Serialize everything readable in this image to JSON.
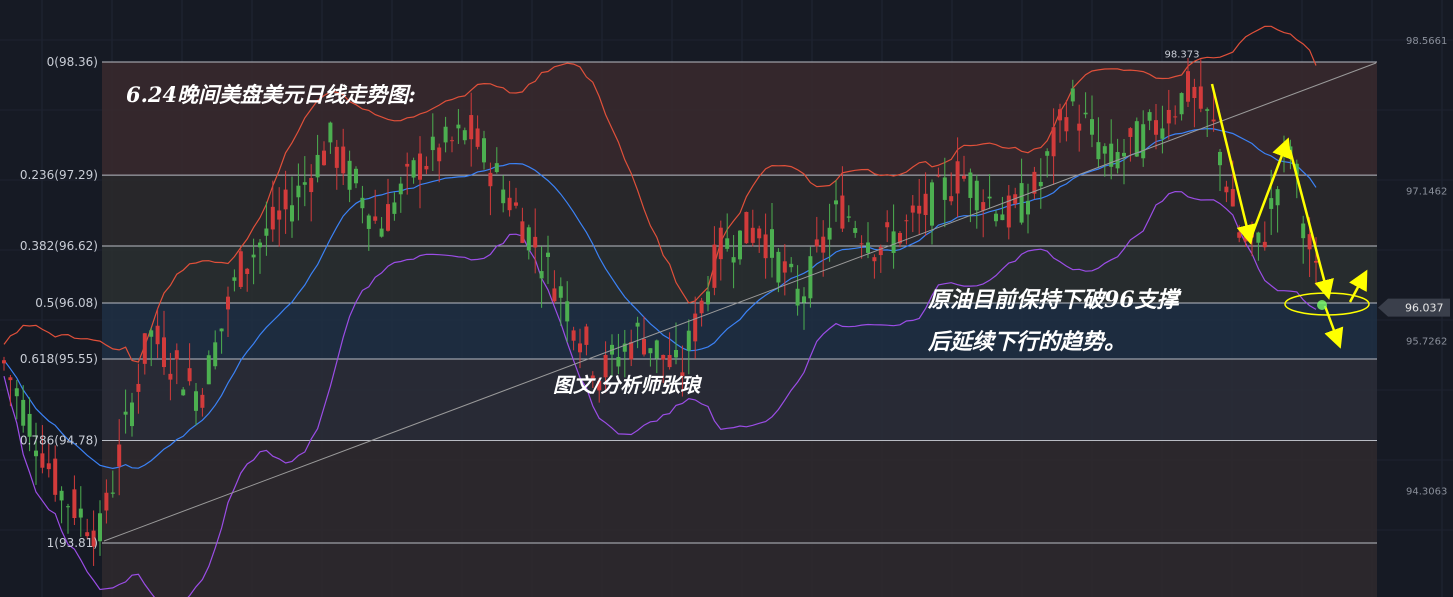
{
  "chart_data": {
    "type": "candlestick",
    "title": "6.24晚间美盘美元日线走势图:",
    "colors": {
      "background": "#161a24",
      "up": "#d23b3b",
      "down": "#4caf50",
      "upper_band": "#e0503a",
      "middle_band": "#3b82f6",
      "lower_band": "#9b4de6",
      "trendline": "#9a9a9a",
      "arrows": "#ffff00",
      "highlight": "#ffff00"
    },
    "ylim": [
      93.3,
      98.9
    ],
    "fib_levels": [
      {
        "label": "0(98.36)",
        "price": 98.36,
        "zone": "#3a2a2e"
      },
      {
        "label": "0.236(97.29)",
        "price": 97.29,
        "zone": "#2c2a2c"
      },
      {
        "label": "0.382(96.62)",
        "price": 96.62,
        "zone": "#2a3030"
      },
      {
        "label": "0.5(96.08)",
        "price": 96.08,
        "zone": "#1f3044"
      },
      {
        "label": "0.618(95.55)",
        "price": 95.55,
        "zone": "#2b2e38"
      },
      {
        "label": "0.786(94.78)",
        "price": 94.78,
        "zone": "#2f2a2e"
      },
      {
        "label": "1(93.81)",
        "price": 93.81,
        "zone": "#2f2a2e"
      }
    ],
    "price_scale": [
      {
        "label": "98.5661",
        "price": 98.5661
      },
      {
        "label": "97.1462",
        "price": 97.1462
      },
      {
        "label": "95.7262",
        "price": 95.7262
      },
      {
        "label": "94.3063",
        "price": 94.3063
      }
    ],
    "current_price": {
      "label": "96.037",
      "price": 96.037
    },
    "high_marker": {
      "label": "98.373",
      "price": 98.373
    },
    "annotations": [
      "原油目前保持下破96支撑",
      "后延续下行的趋势。",
      "图文/分析师张琅"
    ]
  }
}
